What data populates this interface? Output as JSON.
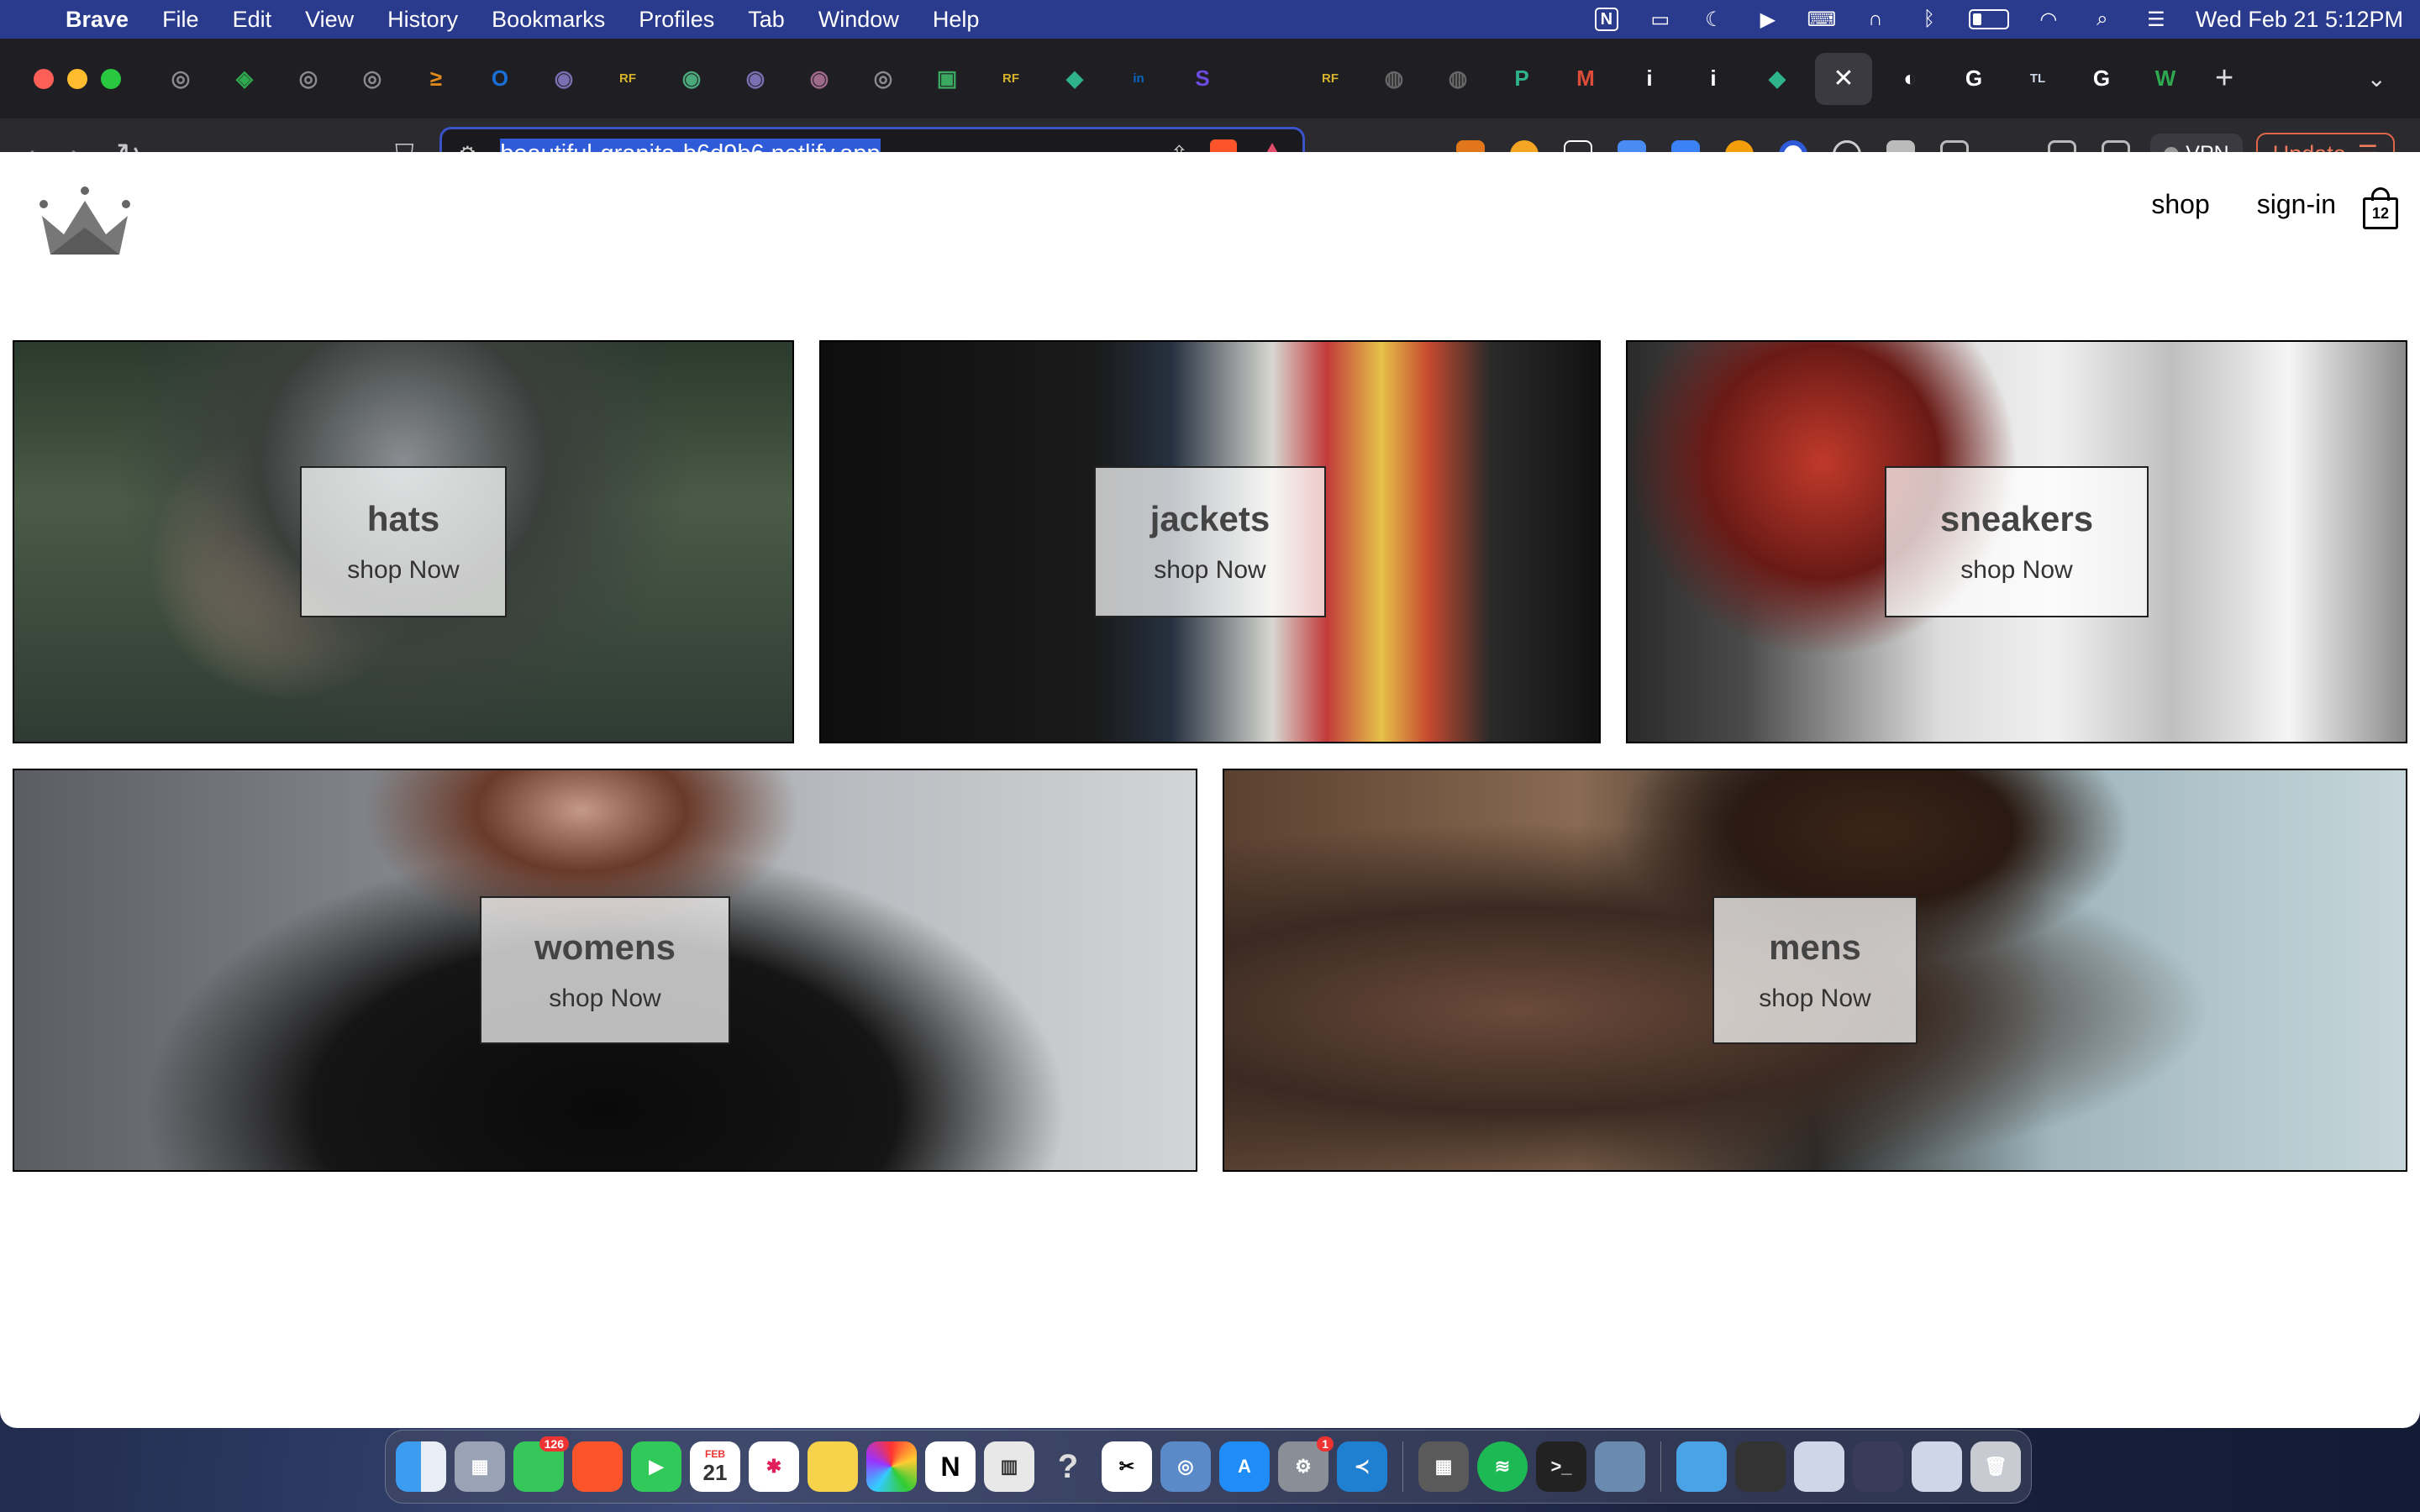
{
  "menubar": {
    "app_name": "Brave",
    "items": [
      "File",
      "Edit",
      "View",
      "History",
      "Bookmarks",
      "Profiles",
      "Tab",
      "Window",
      "Help"
    ],
    "datetime": "Wed Feb 21  5:12PM"
  },
  "browser": {
    "url": "beautiful-granita-b6d9b6.netlify.app",
    "vpn_label": "VPN",
    "update_label": "Update",
    "tabs": [
      {
        "icon": "circle-logo-icon",
        "color": "#8a8a8a",
        "glyph": "◎"
      },
      {
        "icon": "layers-icon",
        "color": "#2fa84f",
        "glyph": "◈"
      },
      {
        "icon": "circle-logo-icon",
        "color": "#8a8a8a",
        "glyph": "◎"
      },
      {
        "icon": "circle-logo-icon",
        "color": "#8a8a8a",
        "glyph": "◎"
      },
      {
        "icon": "arrow-icon",
        "color": "#e08a1a",
        "glyph": "≥"
      },
      {
        "icon": "outlook-icon",
        "color": "#1a6fd6",
        "glyph": "O"
      },
      {
        "icon": "circle-logo-icon",
        "color": "#7a6fb3",
        "glyph": "◉"
      },
      {
        "icon": "rf-icon",
        "color": "#d7b22c",
        "glyph": "RF"
      },
      {
        "icon": "circle-logo-icon",
        "color": "#4aa87a",
        "glyph": "◉"
      },
      {
        "icon": "circle-logo-icon",
        "color": "#7a6fb3",
        "glyph": "◉"
      },
      {
        "icon": "circle-logo-icon",
        "color": "#a06a8a",
        "glyph": "◉"
      },
      {
        "icon": "circle-logo-icon",
        "color": "#8a8a8a",
        "glyph": "◎"
      },
      {
        "icon": "image-icon",
        "color": "#3aa860",
        "glyph": "▣"
      },
      {
        "icon": "rf-icon",
        "color": "#d7b22c",
        "glyph": "RF"
      },
      {
        "icon": "diamond-icon",
        "color": "#2fb38a",
        "glyph": "◆"
      },
      {
        "icon": "linkedin-icon",
        "color": "#0a66c2",
        "glyph": "in"
      },
      {
        "icon": "s-icon",
        "color": "#6a4adf",
        "glyph": "S"
      },
      {
        "icon": "blank-icon",
        "color": "#1f1f23",
        "glyph": ""
      },
      {
        "icon": "rf-icon",
        "color": "#d7b22c",
        "glyph": "RF"
      },
      {
        "icon": "globe-icon",
        "color": "#666",
        "glyph": "◍"
      },
      {
        "icon": "globe-icon",
        "color": "#666",
        "glyph": "◍"
      },
      {
        "icon": "p-icon",
        "color": "#2fb38a",
        "glyph": "P"
      },
      {
        "icon": "gmail-icon",
        "color": "#dd4b39",
        "glyph": "M"
      },
      {
        "icon": "info-icon",
        "color": "#ffffff",
        "glyph": "i"
      },
      {
        "icon": "info-icon",
        "color": "#ffffff",
        "glyph": "i"
      },
      {
        "icon": "diamond-icon",
        "color": "#2fb38a",
        "glyph": "◆"
      }
    ],
    "tabs_after_active": [
      {
        "icon": "github-icon",
        "color": "#ffffff",
        "glyph": "◐"
      },
      {
        "icon": "google-icon",
        "color": "#ffffff",
        "glyph": "G"
      },
      {
        "icon": "tl-icon",
        "color": "#cfd6e8",
        "glyph": "TL"
      },
      {
        "icon": "google-icon",
        "color": "#ffffff",
        "glyph": "G"
      },
      {
        "icon": "w-icon",
        "color": "#2fa84f",
        "glyph": "W"
      }
    ]
  },
  "site": {
    "nav": {
      "shop": "shop",
      "sign_in": "sign-in"
    },
    "cart_count": "12",
    "categories": [
      {
        "title": "hats",
        "cta": "shop Now"
      },
      {
        "title": "jackets",
        "cta": "shop Now"
      },
      {
        "title": "sneakers",
        "cta": "shop Now"
      },
      {
        "title": "womens",
        "cta": "shop Now"
      },
      {
        "title": "mens",
        "cta": "shop Now"
      }
    ]
  },
  "dock": {
    "messages_badge": "126",
    "calendar_month": "FEB",
    "calendar_day": "21",
    "settings_badge": "1"
  }
}
